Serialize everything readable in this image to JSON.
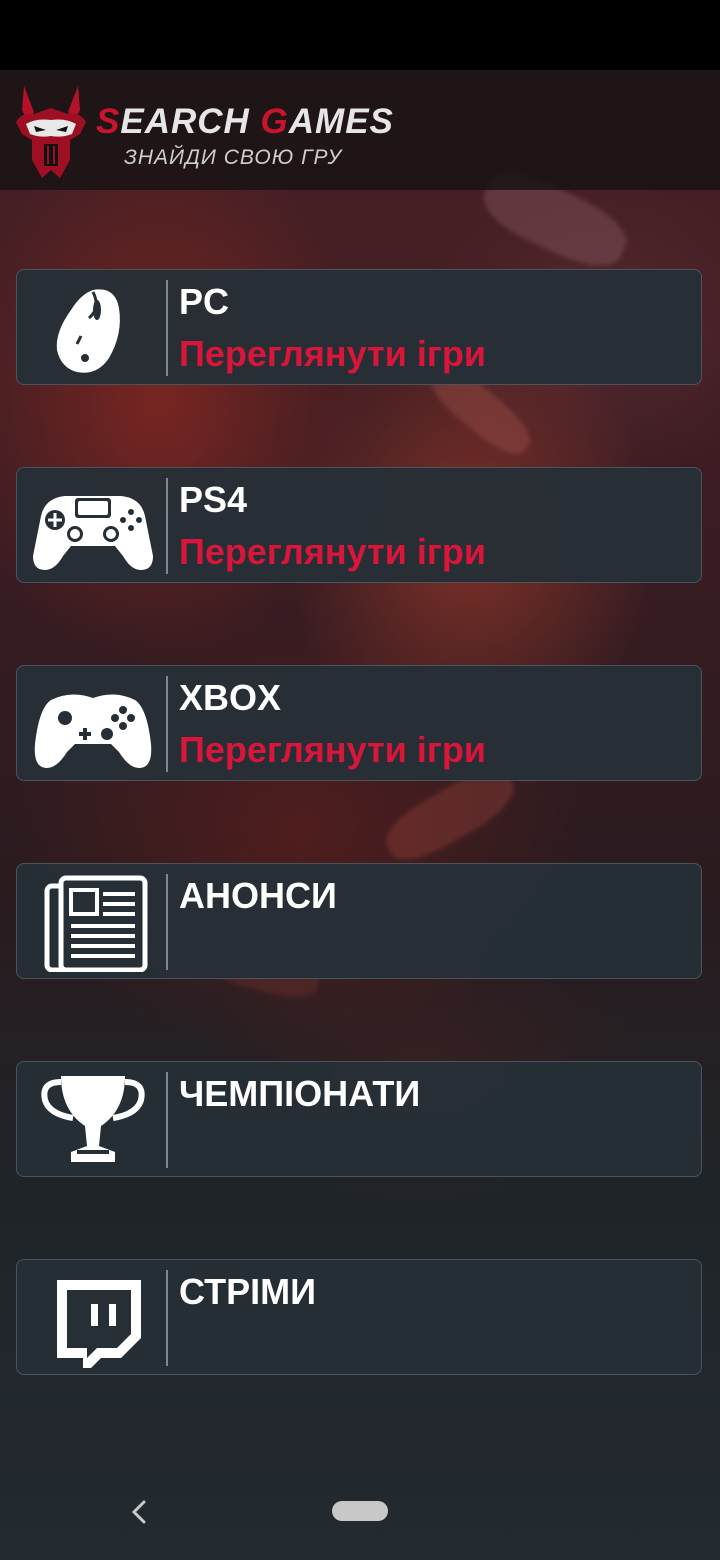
{
  "app": {
    "logo_title_s": "S",
    "logo_title_rest1": "EARCH ",
    "logo_title_g": "G",
    "logo_title_rest2": "AMES",
    "logo_subtitle": "ЗНАЙДИ СВОЮ ГРУ"
  },
  "colors": {
    "accent_red": "#d7163a",
    "card_bg": "#262f36",
    "text_white": "#ffffff"
  },
  "menu": [
    {
      "title": "PC",
      "link": "Переглянути ігри",
      "icon": "mouse-icon"
    },
    {
      "title": "PS4",
      "link": "Переглянути ігри",
      "icon": "ps4-controller-icon"
    },
    {
      "title": "XBOX",
      "link": "Переглянути ігри",
      "icon": "xbox-controller-icon"
    },
    {
      "title": "АНОНСИ",
      "link": "",
      "icon": "newspaper-icon"
    },
    {
      "title": "ЧЕМПІОНАТИ",
      "link": "",
      "icon": "trophy-icon"
    },
    {
      "title": "СТРІМИ",
      "link": "",
      "icon": "twitch-icon"
    }
  ],
  "nav": {
    "back_icon": "back-chevron-icon",
    "home_icon": "home-pill-icon"
  }
}
